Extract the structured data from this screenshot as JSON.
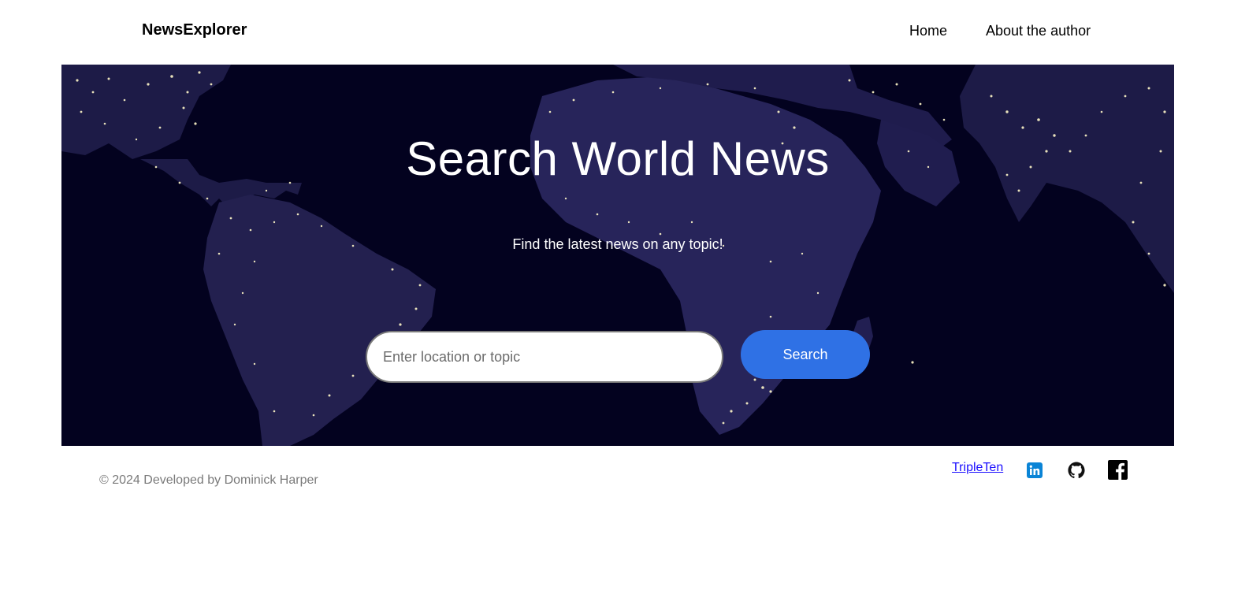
{
  "header": {
    "logo": "NewsExplorer",
    "nav": {
      "home": "Home",
      "about": "About the author"
    }
  },
  "hero": {
    "title": "Search World News",
    "subtitle": "Find the latest news on any topic!",
    "search": {
      "placeholder": "Enter location or topic",
      "button_label": "Search"
    },
    "background": "night-earth-map"
  },
  "footer": {
    "copyright": "© 2024 Developed by Dominick Harper",
    "link": "TripleTen",
    "social": [
      "linkedin-icon",
      "github-icon",
      "facebook-icon"
    ]
  },
  "colors": {
    "accent": "#2f71e5",
    "hero_bg": "#04032a",
    "link": "#1a0dff",
    "muted_text": "#7a7a7a"
  }
}
